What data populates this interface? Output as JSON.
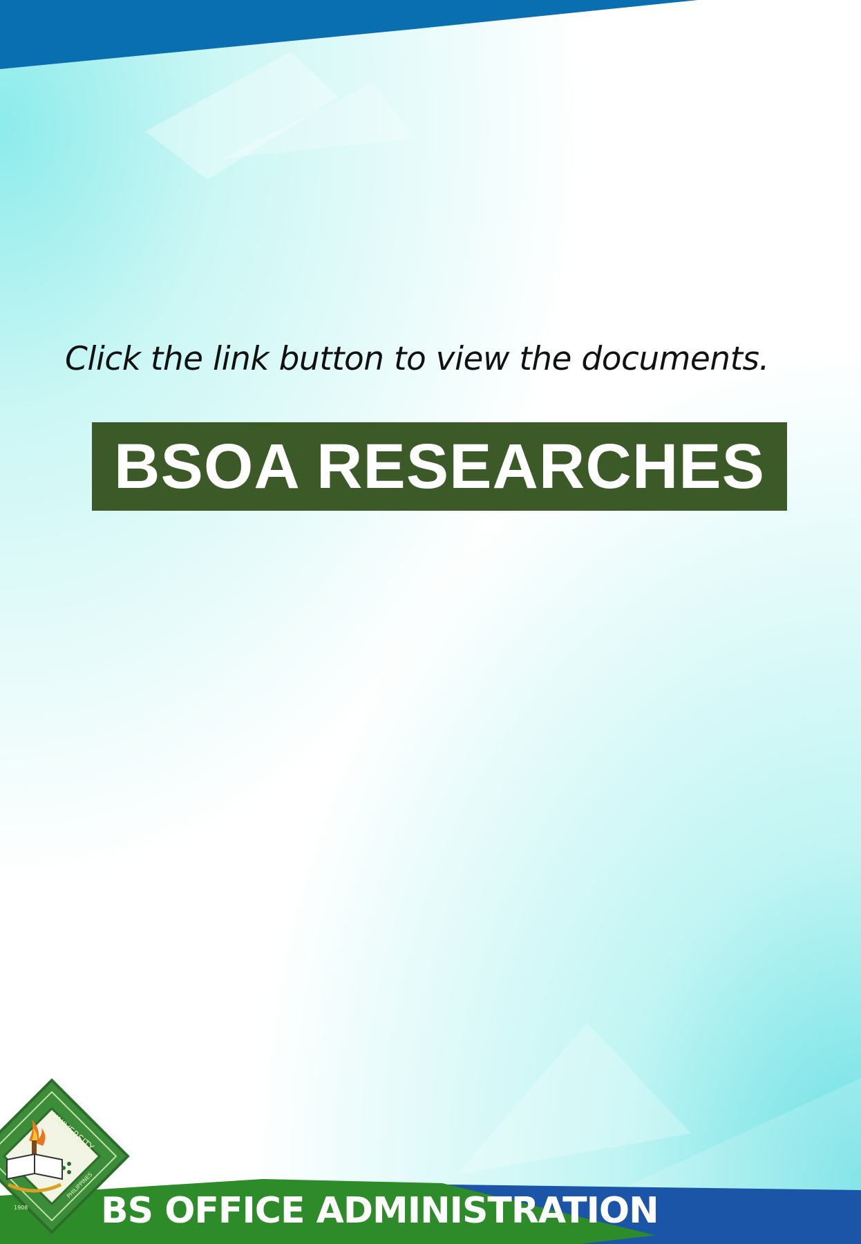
{
  "page": {
    "instruction": "Click the link button to view the documents.",
    "link_button_label": "BSOA RESEARCHES",
    "footer_label": "BS OFFICE ADMINISTRATION"
  },
  "seal": {
    "ring_text_top": "UNIVERSITY",
    "ring_text_bottom": "PHILIPPINES",
    "year": "1908",
    "icon": "university-seal-icon"
  },
  "colors": {
    "button_bg": "#3c5a27",
    "header_band": "#0a6fb0",
    "footer_green": "#2e8b2a",
    "footer_blue": "#1a55a8",
    "seal_green": "#3d8c3a"
  }
}
